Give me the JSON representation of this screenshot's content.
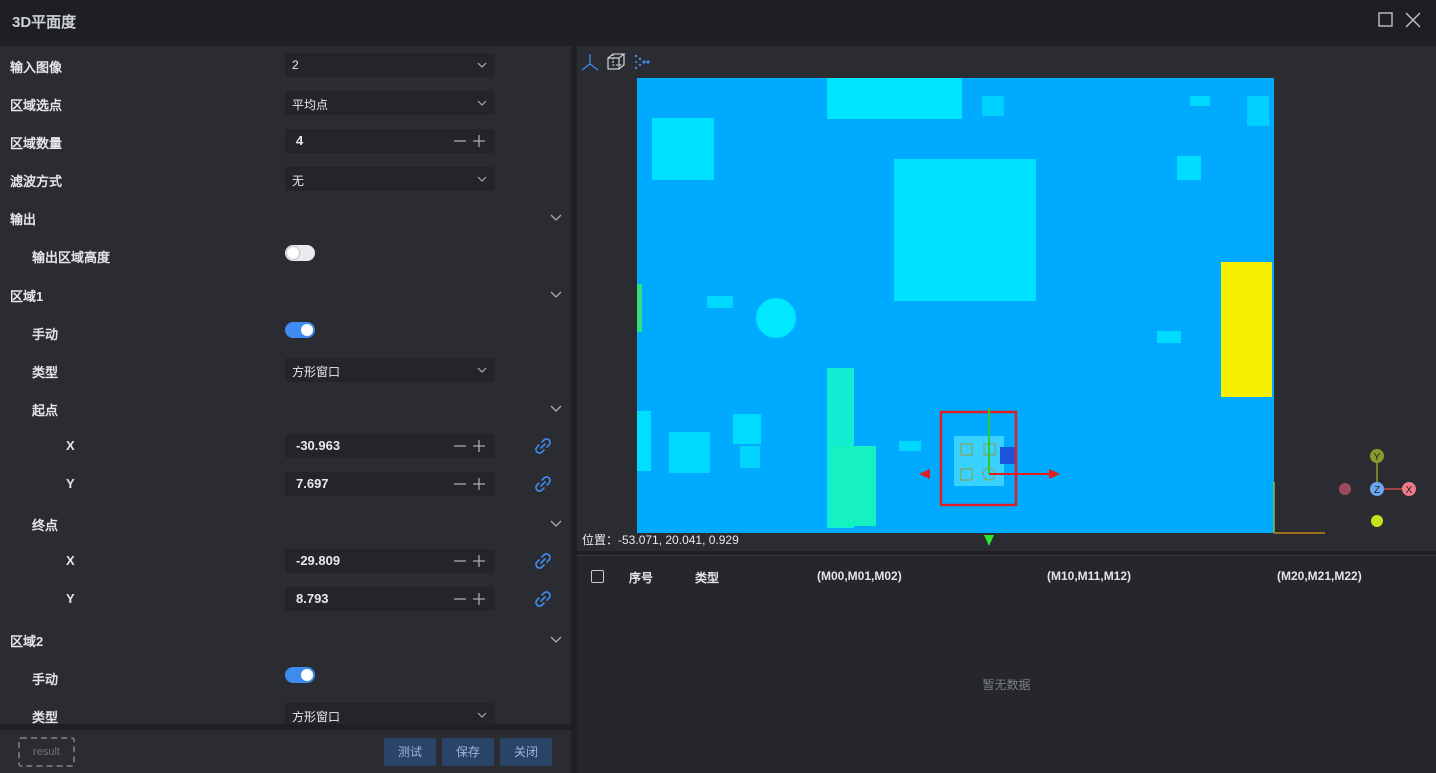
{
  "window": {
    "title": "3D平面度"
  },
  "params": {
    "input_image": {
      "label": "输入图像",
      "value": "2"
    },
    "region_select": {
      "label": "区域选点",
      "value": "平均点"
    },
    "region_count": {
      "label": "区域数量",
      "value": "4"
    },
    "filter": {
      "label": "滤波方式",
      "value": "无"
    },
    "output": {
      "label": "输出",
      "region_height_label": "输出区域高度",
      "region_height_on": false
    },
    "region1": {
      "label": "区域1",
      "manual_label": "手动",
      "manual_on": true,
      "type_label": "类型",
      "type_value": "方形窗口",
      "start_label": "起点",
      "start_x_label": "X",
      "start_x": "-30.963",
      "start_y_label": "Y",
      "start_y": "7.697",
      "end_label": "终点",
      "end_x_label": "X",
      "end_x": "-29.809",
      "end_y_label": "Y",
      "end_y": "8.793"
    },
    "region2": {
      "label": "区域2",
      "manual_label": "手动",
      "manual_on": true,
      "type_label": "类型",
      "type_value": "方形窗口"
    }
  },
  "footer": {
    "result_placeholder": "result",
    "test_label": "测试",
    "save_label": "保存",
    "close_label": "关闭"
  },
  "viewer": {
    "position_label": "位置：",
    "position_value": "-53.071, 20.041, 0.929",
    "axis_labels": {
      "x": "X",
      "y": "Y",
      "z": "Z"
    }
  },
  "table": {
    "columns": [
      "序号",
      "类型",
      "(M00,M01,M02)",
      "(M10,M11,M12)",
      "(M20,M21,M22)"
    ],
    "empty_text": "暂无数据"
  },
  "colors": {
    "height_base": "#00aaff",
    "height_high": "#f4f000",
    "height_mid": "#00e5ff",
    "height_low": "#13f0c0",
    "accent": "#3f8cf0",
    "roi_box": "#e11d1d",
    "button_bg": "#2a4468"
  },
  "icons": {
    "viewer_tools": [
      "axes-icon",
      "cube-wireframe-icon",
      "point-cloud-icon"
    ],
    "window": [
      "maximize-icon",
      "close-icon"
    ],
    "fields": [
      "chevron-down-icon",
      "minus-icon",
      "plus-icon",
      "link-icon"
    ]
  }
}
